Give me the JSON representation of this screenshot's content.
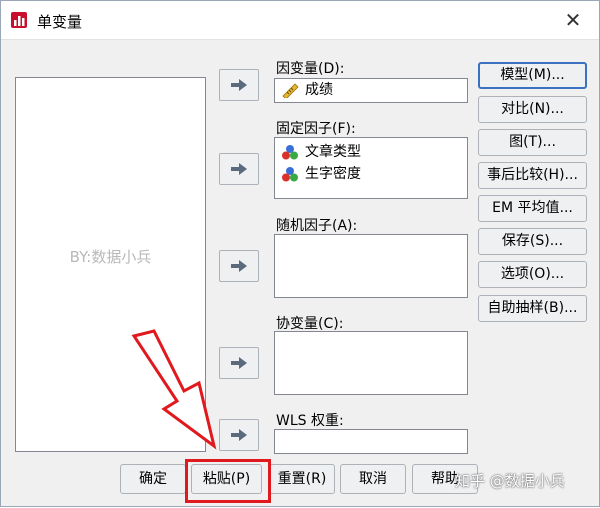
{
  "window": {
    "title": "单变量",
    "close_glyph": "✕"
  },
  "source_list": {
    "watermark": "BY:数据小兵"
  },
  "fields": {
    "dependent": {
      "label": "因变量(D):",
      "items": [
        {
          "name": "成绩",
          "icon": "ruler-scale-icon"
        }
      ]
    },
    "fixed_factor": {
      "label": "固定因子(F):",
      "items": [
        {
          "name": "文章类型",
          "icon": "nominal-balls-icon"
        },
        {
          "name": "生字密度",
          "icon": "nominal-balls-icon"
        }
      ]
    },
    "random_factor": {
      "label": "随机因子(A):"
    },
    "covariate": {
      "label": "协变量(C):"
    },
    "wls_weight": {
      "label": "WLS 权重:"
    }
  },
  "side_buttons": {
    "model": "模型(M)...",
    "contrast": "对比(N)...",
    "plots": "图(T)...",
    "posthoc": "事后比较(H)...",
    "em_means": "EM 平均值...",
    "save": "保存(S)...",
    "options": "选项(O)...",
    "bootstrap": "自助抽样(B)..."
  },
  "bottom_buttons": {
    "ok": "确定",
    "paste": "粘贴(P)",
    "reset": "重置(R)",
    "cancel": "取消",
    "help": "帮助"
  },
  "overlay": {
    "watermark": "知乎 @数据小兵",
    "highlight_color": "#e0191e"
  }
}
